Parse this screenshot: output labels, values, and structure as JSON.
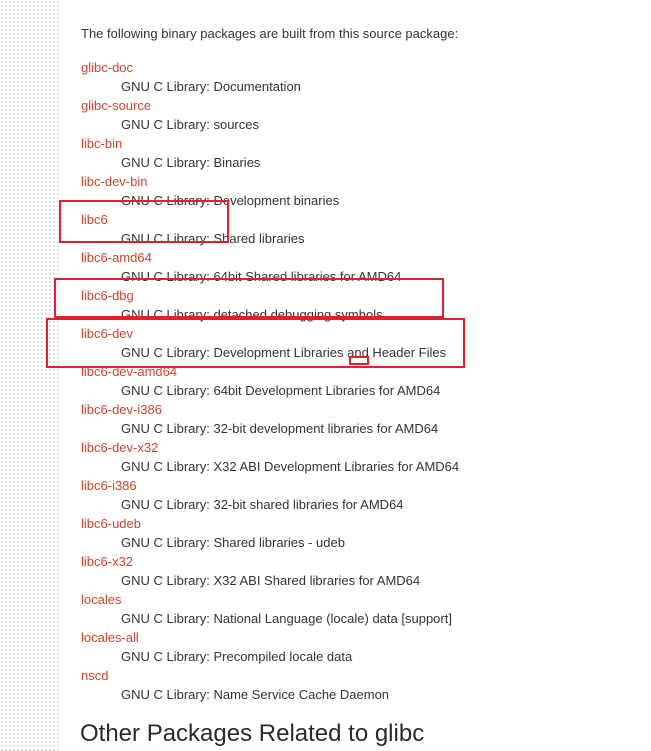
{
  "intro_text": "The following binary packages are built from this source package:",
  "packages": [
    {
      "name": "glibc-doc",
      "description": "GNU C Library: Documentation"
    },
    {
      "name": "glibc-source",
      "description": "GNU C Library: sources"
    },
    {
      "name": "libc-bin",
      "description": "GNU C Library: Binaries"
    },
    {
      "name": "libc-dev-bin",
      "description": "GNU C Library: Development binaries"
    },
    {
      "name": "libc6",
      "description": "GNU C Library: Shared libraries"
    },
    {
      "name": "libc6-amd64",
      "description": "GNU C Library: 64bit Shared libraries for AMD64"
    },
    {
      "name": "libc6-dbg",
      "description": "GNU C Library: detached debugging symbols"
    },
    {
      "name": "libc6-dev",
      "description": "GNU C Library: Development Libraries and Header Files"
    },
    {
      "name": "libc6-dev-amd64",
      "description": "GNU C Library: 64bit Development Libraries for AMD64"
    },
    {
      "name": "libc6-dev-i386",
      "description": "GNU C Library: 32-bit development libraries for AMD64"
    },
    {
      "name": "libc6-dev-x32",
      "description": "GNU C Library: X32 ABI Development Libraries for AMD64"
    },
    {
      "name": "libc6-i386",
      "description": "GNU C Library: 32-bit shared libraries for AMD64"
    },
    {
      "name": "libc6-udeb",
      "description": "GNU C Library: Shared libraries - udeb"
    },
    {
      "name": "libc6-x32",
      "description": "GNU C Library: X32 ABI Shared libraries for AMD64"
    },
    {
      "name": "locales",
      "description": "GNU C Library: National Language (locale) data [support]"
    },
    {
      "name": "locales-all",
      "description": "GNU C Library: Precompiled locale data"
    },
    {
      "name": "nscd",
      "description": "GNU C Library: Name Service Cache Daemon"
    }
  ],
  "section_heading": "Other Packages Related to glibc",
  "colors": {
    "link": "#c8462c",
    "text": "#333333",
    "highlight": "#e0202a"
  }
}
